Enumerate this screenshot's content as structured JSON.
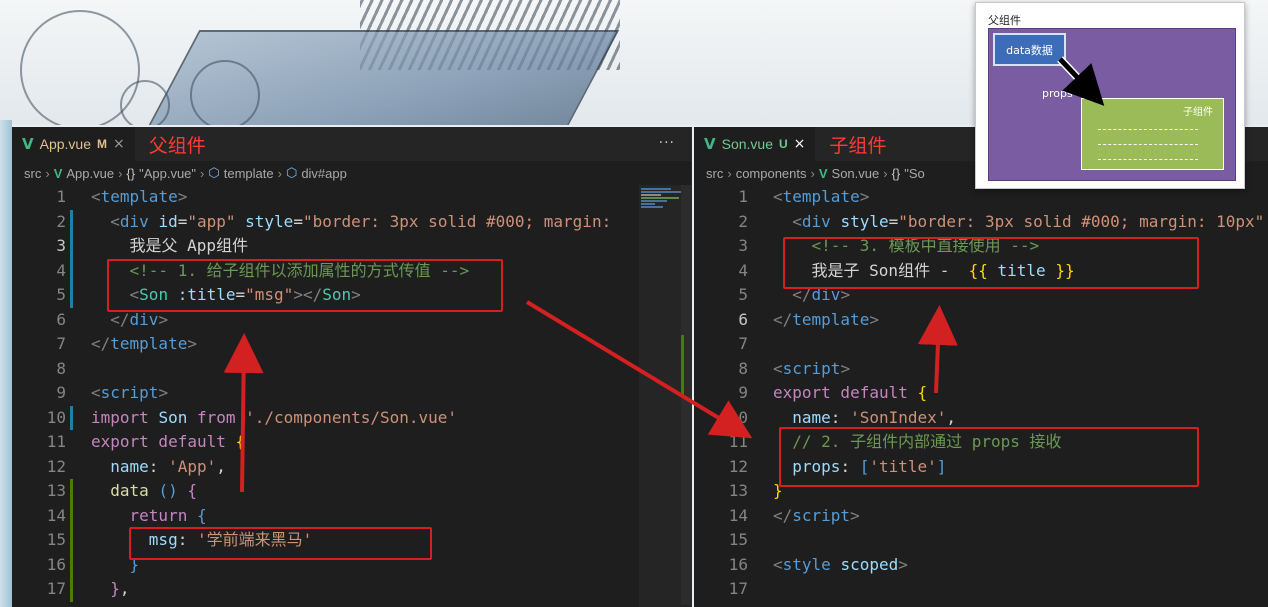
{
  "left_editor": {
    "tab": {
      "filename": "App.vue",
      "badge": "M",
      "close": "×"
    },
    "annotation": "父组件",
    "more": "···",
    "breadcrumb": [
      "src",
      "App.vue",
      "\"App.vue\"",
      "template",
      "div#app"
    ],
    "lines": [
      {
        "n": "1",
        "t": [
          [
            "c-br",
            "<"
          ],
          [
            "c-tag",
            "template"
          ],
          [
            "c-br",
            ">"
          ]
        ]
      },
      {
        "n": "2",
        "t": [
          [
            "c-txt",
            "  "
          ],
          [
            "c-br",
            "<"
          ],
          [
            "c-tag",
            "div "
          ],
          [
            "c-attr",
            "id"
          ],
          [
            "c-pun",
            "="
          ],
          [
            "c-str",
            "\"app\" "
          ],
          [
            "c-attr",
            "style"
          ],
          [
            "c-pun",
            "="
          ],
          [
            "c-str",
            "\"border: 3px solid #000; margin:"
          ]
        ]
      },
      {
        "n": "3",
        "t": [
          [
            "c-txt",
            "    我是父 App组件"
          ]
        ]
      },
      {
        "n": "4",
        "t": [
          [
            "c-txt",
            "    "
          ],
          [
            "c-cm",
            "<!-- 1. 给子组件以添加属性的方式传值 -->"
          ]
        ]
      },
      {
        "n": "5",
        "t": [
          [
            "c-txt",
            "    "
          ],
          [
            "c-br",
            "<"
          ],
          [
            "c-comp",
            "Son "
          ],
          [
            "c-attr",
            ":title"
          ],
          [
            "c-pun",
            "="
          ],
          [
            "c-str",
            "\"msg\""
          ],
          [
            "c-br",
            "></"
          ],
          [
            "c-comp",
            "Son"
          ],
          [
            "c-br",
            ">"
          ]
        ]
      },
      {
        "n": "6",
        "t": [
          [
            "c-txt",
            "  "
          ],
          [
            "c-br",
            "</"
          ],
          [
            "c-tag",
            "div"
          ],
          [
            "c-br",
            ">"
          ]
        ]
      },
      {
        "n": "7",
        "t": [
          [
            "c-br",
            "</"
          ],
          [
            "c-tag",
            "template"
          ],
          [
            "c-br",
            ">"
          ]
        ]
      },
      {
        "n": "8",
        "t": []
      },
      {
        "n": "9",
        "t": [
          [
            "c-br",
            "<"
          ],
          [
            "c-tag",
            "script"
          ],
          [
            "c-br",
            ">"
          ]
        ]
      },
      {
        "n": "10",
        "t": [
          [
            "c-kw",
            "import "
          ],
          [
            "c-prop",
            "Son "
          ],
          [
            "c-kw",
            "from "
          ],
          [
            "c-str",
            "'./components/Son.vue'"
          ]
        ]
      },
      {
        "n": "11",
        "t": [
          [
            "c-kw",
            "export default "
          ],
          [
            "c-yel",
            "{"
          ]
        ]
      },
      {
        "n": "12",
        "t": [
          [
            "c-txt",
            "  "
          ],
          [
            "c-prop",
            "name"
          ],
          [
            "c-pun",
            ": "
          ],
          [
            "c-str",
            "'App'"
          ],
          [
            "c-pun",
            ","
          ]
        ]
      },
      {
        "n": "13",
        "t": [
          [
            "c-txt",
            "  "
          ],
          [
            "c-fn",
            "data "
          ],
          [
            "c-kw2",
            "()"
          ],
          [
            "c-pun",
            " "
          ],
          [
            "c-kw",
            "{"
          ]
        ]
      },
      {
        "n": "14",
        "t": [
          [
            "c-txt",
            "    "
          ],
          [
            "c-kw",
            "return "
          ],
          [
            "c-kw2",
            "{"
          ]
        ]
      },
      {
        "n": "15",
        "t": [
          [
            "c-txt",
            "      "
          ],
          [
            "c-prop",
            "msg"
          ],
          [
            "c-pun",
            ": "
          ],
          [
            "c-str",
            "'学前端来黑马'"
          ]
        ]
      },
      {
        "n": "16",
        "t": [
          [
            "c-txt",
            "    "
          ],
          [
            "c-kw2",
            "}"
          ]
        ]
      },
      {
        "n": "17",
        "t": [
          [
            "c-txt",
            "  "
          ],
          [
            "c-kw",
            "}"
          ],
          [
            "c-pun",
            ","
          ]
        ]
      }
    ]
  },
  "right_editor": {
    "tab": {
      "filename": "Son.vue",
      "badge": "U",
      "close": "×"
    },
    "annotation": "子组件",
    "breadcrumb": [
      "src",
      "components",
      "Son.vue",
      "\"So"
    ],
    "lines": [
      {
        "n": "1",
        "t": [
          [
            "c-br",
            "<"
          ],
          [
            "c-tag",
            "template"
          ],
          [
            "c-br",
            ">"
          ]
        ]
      },
      {
        "n": "2",
        "t": [
          [
            "c-txt",
            "  "
          ],
          [
            "c-br",
            "<"
          ],
          [
            "c-tag",
            "div "
          ],
          [
            "c-attr",
            "style"
          ],
          [
            "c-pun",
            "="
          ],
          [
            "c-str",
            "\"border: 3px solid #000; margin: 10px\""
          ]
        ]
      },
      {
        "n": "3",
        "t": [
          [
            "c-txt",
            "    "
          ],
          [
            "c-cm",
            "<!-- 3. 模板中直接使用 -->"
          ]
        ]
      },
      {
        "n": "4",
        "t": [
          [
            "c-txt",
            "    我是子 Son组件 -  "
          ],
          [
            "c-yel",
            "{{ "
          ],
          [
            "c-prop",
            "title "
          ],
          [
            "c-yel",
            "}}"
          ]
        ]
      },
      {
        "n": "5",
        "t": [
          [
            "c-txt",
            "  "
          ],
          [
            "c-br",
            "</"
          ],
          [
            "c-tag",
            "div"
          ],
          [
            "c-br",
            ">"
          ]
        ]
      },
      {
        "n": "6",
        "t": [
          [
            "c-br",
            "</"
          ],
          [
            "c-tag",
            "template"
          ],
          [
            "c-br",
            ">"
          ]
        ]
      },
      {
        "n": "7",
        "t": []
      },
      {
        "n": "8",
        "t": [
          [
            "c-br",
            "<"
          ],
          [
            "c-tag",
            "script"
          ],
          [
            "c-br",
            ">"
          ]
        ]
      },
      {
        "n": "9",
        "t": [
          [
            "c-kw",
            "export default "
          ],
          [
            "c-yel",
            "{"
          ]
        ]
      },
      {
        "n": "10",
        "t": [
          [
            "c-txt",
            "  "
          ],
          [
            "c-prop",
            "name"
          ],
          [
            "c-pun",
            ": "
          ],
          [
            "c-str",
            "'SonIndex'"
          ],
          [
            "c-pun",
            ","
          ]
        ]
      },
      {
        "n": "11",
        "t": [
          [
            "c-txt",
            "  "
          ],
          [
            "c-cm",
            "// 2. 子组件内部通过 props 接收"
          ]
        ]
      },
      {
        "n": "12",
        "t": [
          [
            "c-txt",
            "  "
          ],
          [
            "c-prop",
            "props"
          ],
          [
            "c-pun",
            ": "
          ],
          [
            "c-kw2",
            "["
          ],
          [
            "c-str",
            "'title'"
          ],
          [
            "c-kw2",
            "]"
          ]
        ]
      },
      {
        "n": "13",
        "t": [
          [
            "c-yel",
            "}"
          ]
        ]
      },
      {
        "n": "14",
        "t": [
          [
            "c-br",
            "</"
          ],
          [
            "c-tag",
            "script"
          ],
          [
            "c-br",
            ">"
          ]
        ]
      },
      {
        "n": "15",
        "t": []
      },
      {
        "n": "16",
        "t": [
          [
            "c-br",
            "<"
          ],
          [
            "c-tag",
            "style "
          ],
          [
            "c-attr",
            "scoped"
          ],
          [
            "c-br",
            ">"
          ]
        ]
      },
      {
        "n": "17",
        "t": []
      }
    ]
  },
  "diagram": {
    "parent_label": "父组件",
    "data_label": "data数据",
    "props_label": "props",
    "child_label": "子组件"
  },
  "colors": {
    "annotation": "#ff3b2f",
    "arrow": "#d32020",
    "vue_green": "#41b883"
  }
}
